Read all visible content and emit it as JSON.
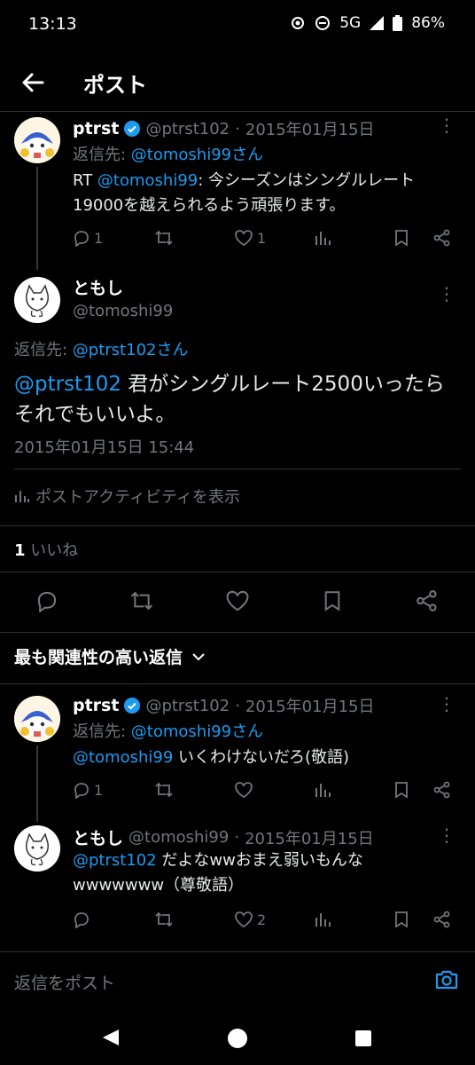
{
  "status_bar": {
    "time": "13:13",
    "network": "5G",
    "battery": "86%"
  },
  "header": {
    "title": "ポスト"
  },
  "parent_post": {
    "name": "ptrst",
    "handle": "@ptrst102",
    "dot": "·",
    "date": "2015年01月15日",
    "reply_to_prefix": "返信先: ",
    "reply_to_handle": "@tomoshi99さん",
    "text_prefix": "RT ",
    "text_mention": "@tomoshi99",
    "text_body": ": 今シーズンはシングルレート19000を越えられるよう頑張ります。",
    "reply_count": "1",
    "like_count": "1"
  },
  "main_post": {
    "name": "ともし",
    "handle": "@tomoshi99",
    "reply_to_prefix": "返信先: ",
    "reply_to_handle": "@ptrst102さん",
    "text_mention": "@ptrst102",
    "text_body": " 君がシングルレート2500いったらそれでもいいよ。",
    "timestamp": "2015年01月15日 15:44",
    "activity_label": "ポストアクティビティを表示",
    "like_count": "1",
    "like_label": "いいね"
  },
  "replies_section": {
    "sort_label": "最も関連性の高い返信"
  },
  "reply_1": {
    "name": "ptrst",
    "handle": "@ptrst102",
    "dot": "·",
    "date": "2015年01月15日",
    "reply_to_prefix": "返信先: ",
    "reply_to_handle": "@tomoshi99さん",
    "text_mention": "@tomoshi99",
    "text_body": " いくわけないだろ(敬語)",
    "reply_count": "1"
  },
  "reply_2": {
    "name": "ともし",
    "handle": "@tomoshi99",
    "dot": "·",
    "date": "2015年01月15日",
    "text_mention": "@ptrst102",
    "text_body": " だよなwwおまえ弱いもんなwwwwwww（尊敬語）",
    "like_count": "2"
  },
  "reply_input": {
    "placeholder": "返信をポスト"
  },
  "colors": {
    "background": "#000000",
    "accent": "#1d9bf0",
    "muted": "#71767b",
    "verified": "#1d9bf0"
  }
}
